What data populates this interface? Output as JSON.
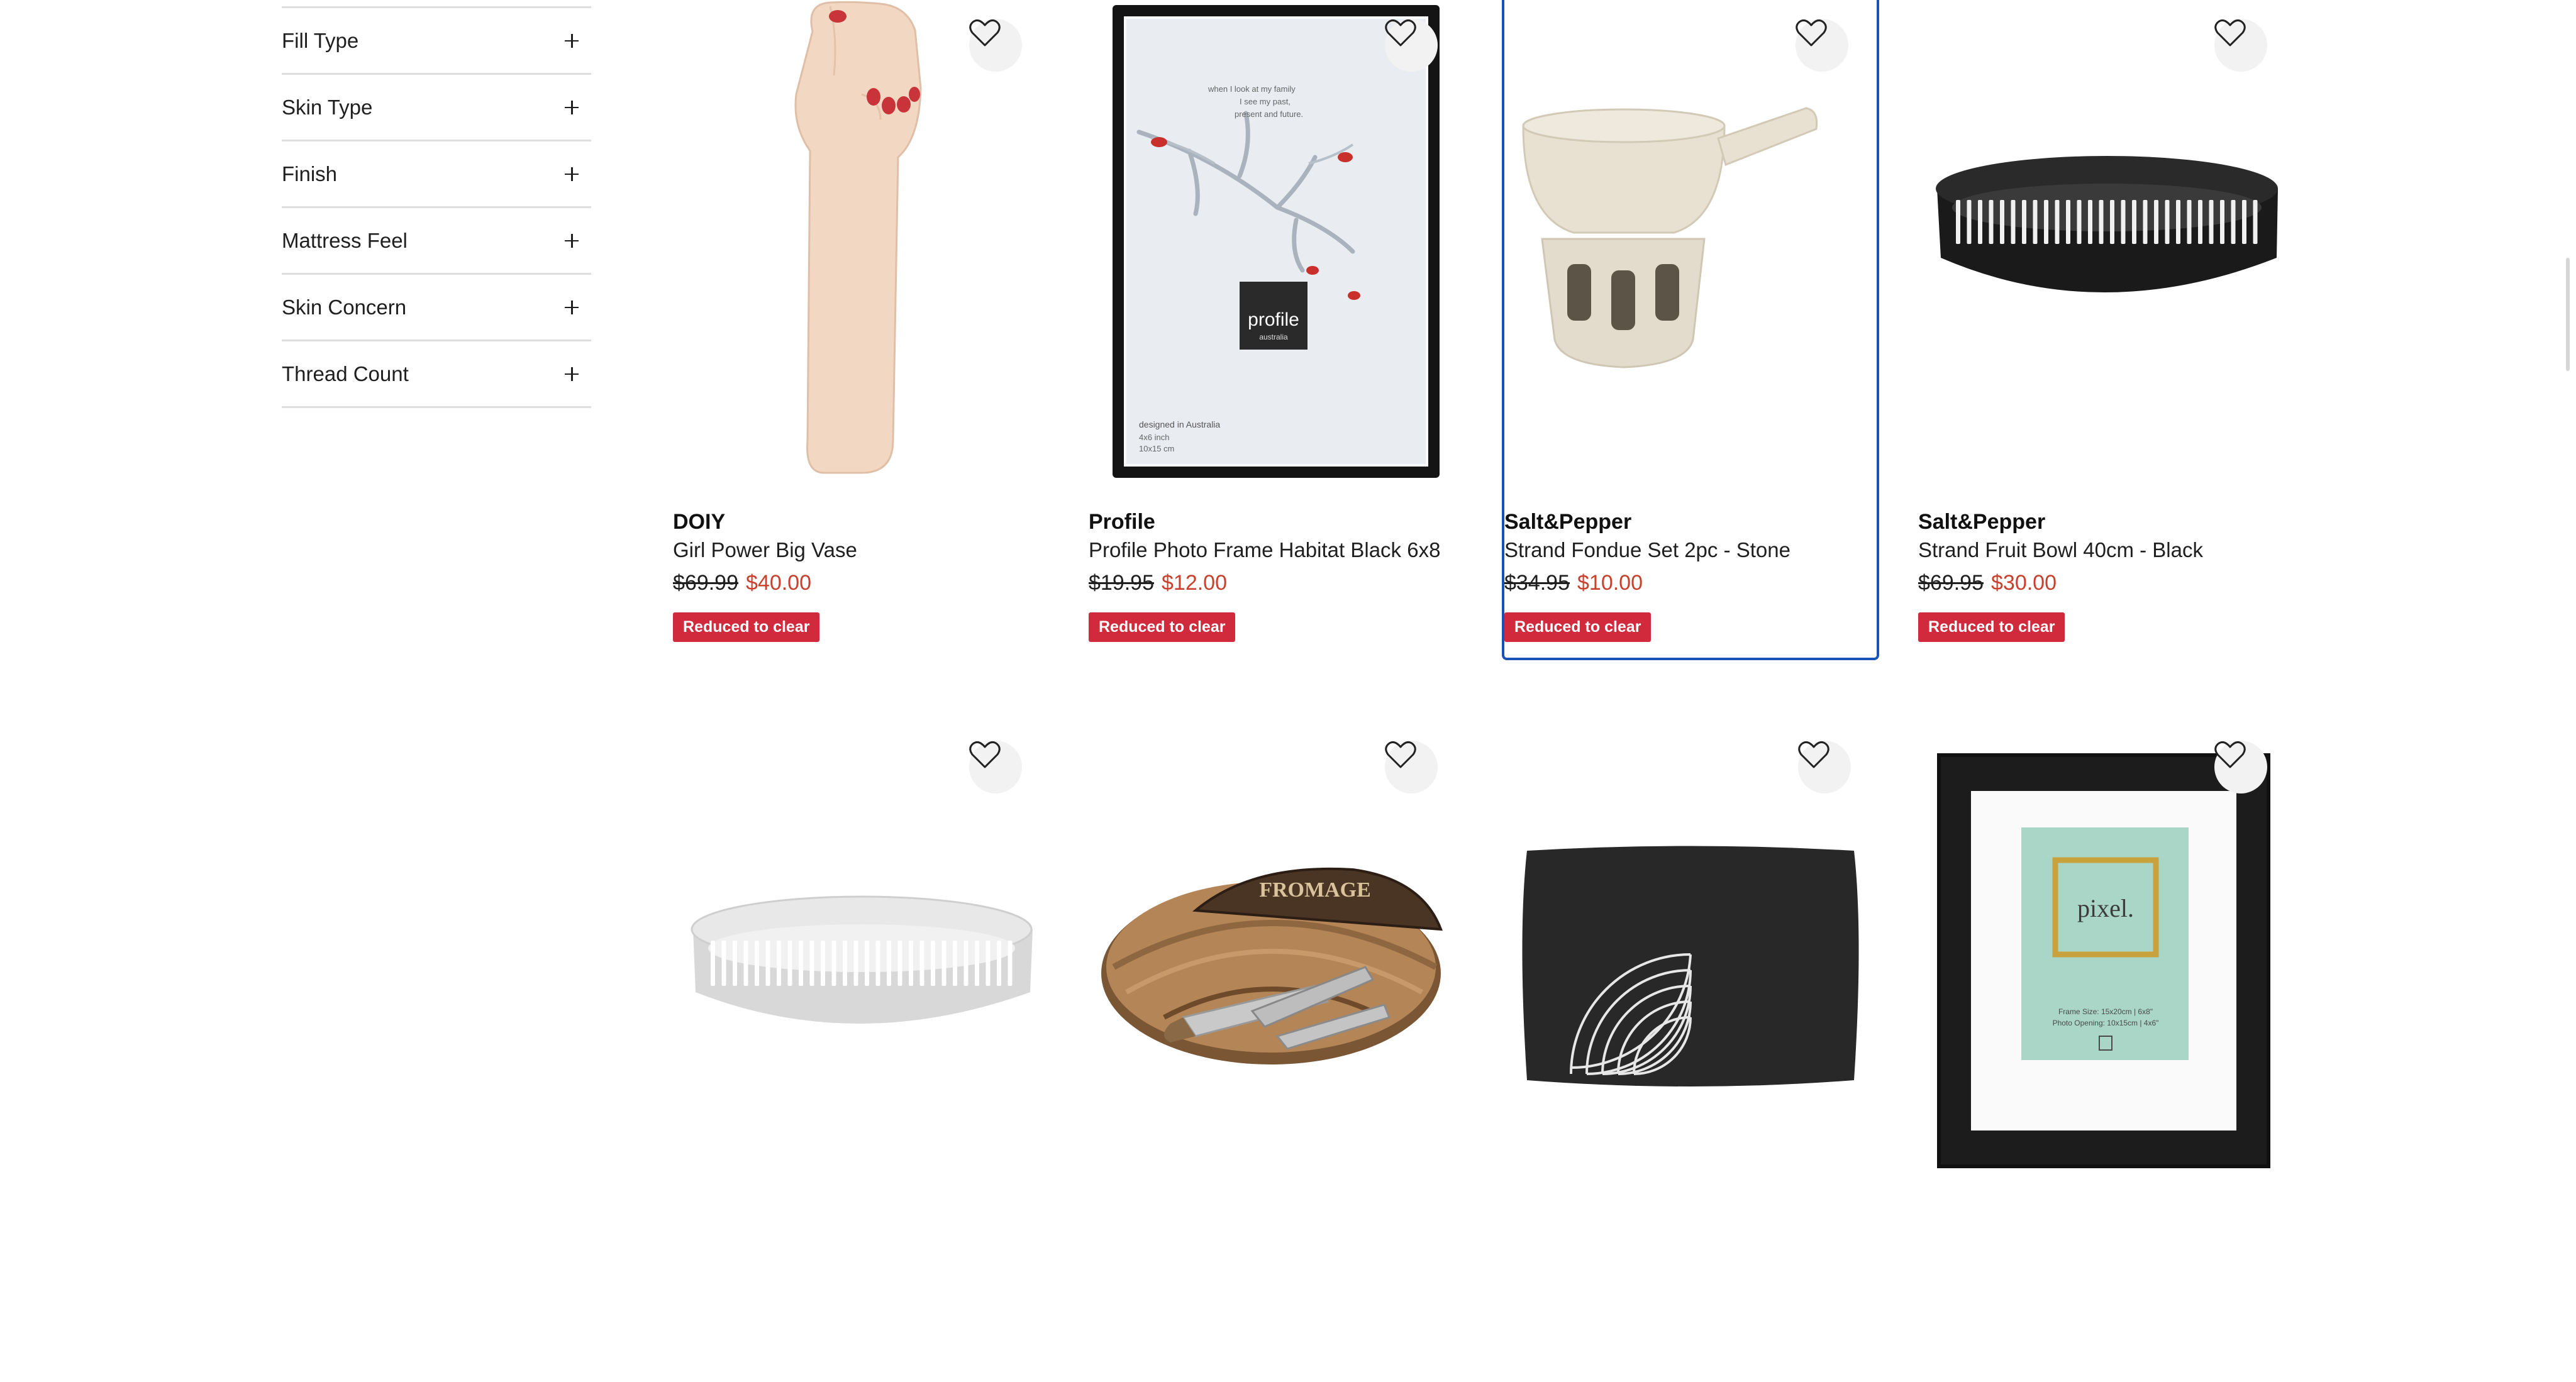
{
  "filters": [
    {
      "label": "Fill Type"
    },
    {
      "label": "Skin Type"
    },
    {
      "label": "Finish"
    },
    {
      "label": "Mattress Feel"
    },
    {
      "label": "Skin Concern"
    },
    {
      "label": "Thread Count"
    }
  ],
  "products": [
    {
      "brand": "DOIY",
      "name": "Girl Power Big Vase",
      "was": "$69.99",
      "now": "$40.00",
      "badge": "Reduced to clear",
      "image": "raised-fist-vase"
    },
    {
      "brand": "Profile",
      "name": "Profile Photo Frame Habitat Black 6x8",
      "was": "$19.95",
      "now": "$12.00",
      "badge": "Reduced to clear",
      "image": "black-photo-frame"
    },
    {
      "brand": "Salt&Pepper",
      "name": "Strand Fondue Set 2pc - Stone",
      "was": "$34.95",
      "now": "$10.00",
      "badge": "Reduced to clear",
      "image": "stone-fondue-set"
    },
    {
      "brand": "Salt&Pepper",
      "name": "Strand Fruit Bowl 40cm - Black",
      "was": "$69.95",
      "now": "$30.00",
      "badge": "Reduced to clear",
      "image": "black-fruit-bowl"
    },
    {
      "image": "white-slatted-bowl"
    },
    {
      "image": "fromage-cheese-board"
    },
    {
      "image": "black-arc-cushion"
    },
    {
      "image": "pixel-photo-frame"
    }
  ],
  "image_text": {
    "frame_quote_1": "when I look at my family",
    "frame_quote_2": "I see my past,",
    "frame_quote_3": "present and future.",
    "frame_logo": "profile",
    "frame_logo_sub": "australia",
    "frame_footer_1": "designed in Australia",
    "frame_footer_2": "4x6 inch",
    "frame_footer_3": "10x15 cm",
    "board_text_1": "FROMAGE",
    "pixel_logo": "pixel.",
    "pixel_size_1": "Frame Size: 15x20cm | 6x8\"",
    "pixel_size_2": "Photo Opening: 10x15cm | 4x6\""
  },
  "colors": {
    "accent_selected": "#1b52b6",
    "sale_price": "#c9402c",
    "badge": "#d02a3c"
  }
}
